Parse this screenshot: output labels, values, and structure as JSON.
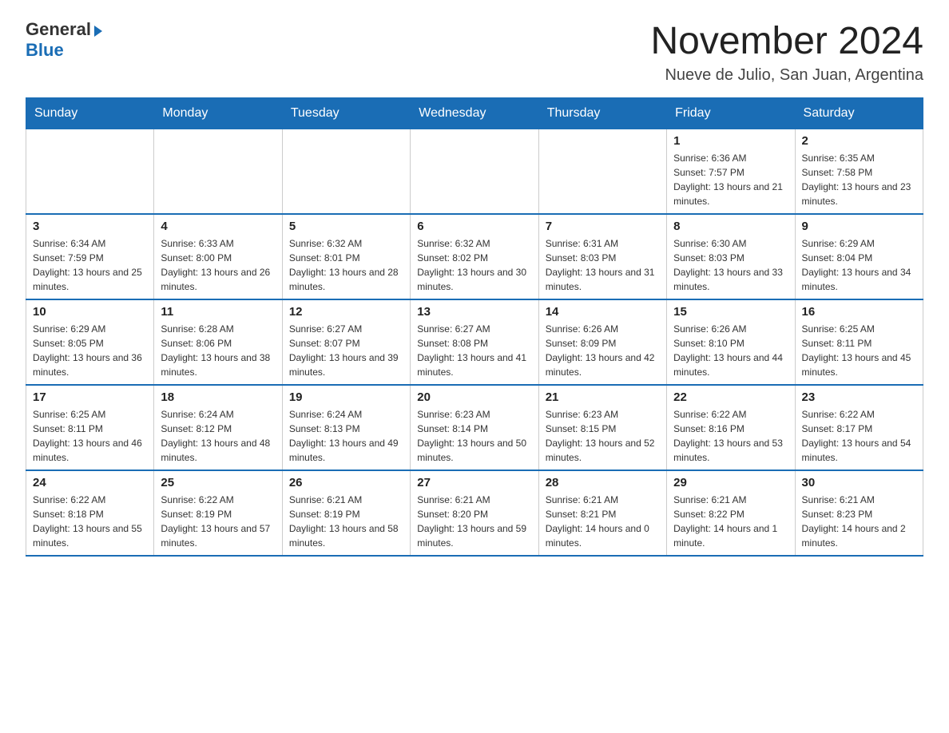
{
  "header": {
    "logo_general": "General",
    "logo_blue": "Blue",
    "title": "November 2024",
    "subtitle": "Nueve de Julio, San Juan, Argentina"
  },
  "days_of_week": [
    "Sunday",
    "Monday",
    "Tuesday",
    "Wednesday",
    "Thursday",
    "Friday",
    "Saturday"
  ],
  "weeks": [
    [
      {
        "day": "",
        "info": ""
      },
      {
        "day": "",
        "info": ""
      },
      {
        "day": "",
        "info": ""
      },
      {
        "day": "",
        "info": ""
      },
      {
        "day": "",
        "info": ""
      },
      {
        "day": "1",
        "info": "Sunrise: 6:36 AM\nSunset: 7:57 PM\nDaylight: 13 hours and 21 minutes."
      },
      {
        "day": "2",
        "info": "Sunrise: 6:35 AM\nSunset: 7:58 PM\nDaylight: 13 hours and 23 minutes."
      }
    ],
    [
      {
        "day": "3",
        "info": "Sunrise: 6:34 AM\nSunset: 7:59 PM\nDaylight: 13 hours and 25 minutes."
      },
      {
        "day": "4",
        "info": "Sunrise: 6:33 AM\nSunset: 8:00 PM\nDaylight: 13 hours and 26 minutes."
      },
      {
        "day": "5",
        "info": "Sunrise: 6:32 AM\nSunset: 8:01 PM\nDaylight: 13 hours and 28 minutes."
      },
      {
        "day": "6",
        "info": "Sunrise: 6:32 AM\nSunset: 8:02 PM\nDaylight: 13 hours and 30 minutes."
      },
      {
        "day": "7",
        "info": "Sunrise: 6:31 AM\nSunset: 8:03 PM\nDaylight: 13 hours and 31 minutes."
      },
      {
        "day": "8",
        "info": "Sunrise: 6:30 AM\nSunset: 8:03 PM\nDaylight: 13 hours and 33 minutes."
      },
      {
        "day": "9",
        "info": "Sunrise: 6:29 AM\nSunset: 8:04 PM\nDaylight: 13 hours and 34 minutes."
      }
    ],
    [
      {
        "day": "10",
        "info": "Sunrise: 6:29 AM\nSunset: 8:05 PM\nDaylight: 13 hours and 36 minutes."
      },
      {
        "day": "11",
        "info": "Sunrise: 6:28 AM\nSunset: 8:06 PM\nDaylight: 13 hours and 38 minutes."
      },
      {
        "day": "12",
        "info": "Sunrise: 6:27 AM\nSunset: 8:07 PM\nDaylight: 13 hours and 39 minutes."
      },
      {
        "day": "13",
        "info": "Sunrise: 6:27 AM\nSunset: 8:08 PM\nDaylight: 13 hours and 41 minutes."
      },
      {
        "day": "14",
        "info": "Sunrise: 6:26 AM\nSunset: 8:09 PM\nDaylight: 13 hours and 42 minutes."
      },
      {
        "day": "15",
        "info": "Sunrise: 6:26 AM\nSunset: 8:10 PM\nDaylight: 13 hours and 44 minutes."
      },
      {
        "day": "16",
        "info": "Sunrise: 6:25 AM\nSunset: 8:11 PM\nDaylight: 13 hours and 45 minutes."
      }
    ],
    [
      {
        "day": "17",
        "info": "Sunrise: 6:25 AM\nSunset: 8:11 PM\nDaylight: 13 hours and 46 minutes."
      },
      {
        "day": "18",
        "info": "Sunrise: 6:24 AM\nSunset: 8:12 PM\nDaylight: 13 hours and 48 minutes."
      },
      {
        "day": "19",
        "info": "Sunrise: 6:24 AM\nSunset: 8:13 PM\nDaylight: 13 hours and 49 minutes."
      },
      {
        "day": "20",
        "info": "Sunrise: 6:23 AM\nSunset: 8:14 PM\nDaylight: 13 hours and 50 minutes."
      },
      {
        "day": "21",
        "info": "Sunrise: 6:23 AM\nSunset: 8:15 PM\nDaylight: 13 hours and 52 minutes."
      },
      {
        "day": "22",
        "info": "Sunrise: 6:22 AM\nSunset: 8:16 PM\nDaylight: 13 hours and 53 minutes."
      },
      {
        "day": "23",
        "info": "Sunrise: 6:22 AM\nSunset: 8:17 PM\nDaylight: 13 hours and 54 minutes."
      }
    ],
    [
      {
        "day": "24",
        "info": "Sunrise: 6:22 AM\nSunset: 8:18 PM\nDaylight: 13 hours and 55 minutes."
      },
      {
        "day": "25",
        "info": "Sunrise: 6:22 AM\nSunset: 8:19 PM\nDaylight: 13 hours and 57 minutes."
      },
      {
        "day": "26",
        "info": "Sunrise: 6:21 AM\nSunset: 8:19 PM\nDaylight: 13 hours and 58 minutes."
      },
      {
        "day": "27",
        "info": "Sunrise: 6:21 AM\nSunset: 8:20 PM\nDaylight: 13 hours and 59 minutes."
      },
      {
        "day": "28",
        "info": "Sunrise: 6:21 AM\nSunset: 8:21 PM\nDaylight: 14 hours and 0 minutes."
      },
      {
        "day": "29",
        "info": "Sunrise: 6:21 AM\nSunset: 8:22 PM\nDaylight: 14 hours and 1 minute."
      },
      {
        "day": "30",
        "info": "Sunrise: 6:21 AM\nSunset: 8:23 PM\nDaylight: 14 hours and 2 minutes."
      }
    ]
  ]
}
